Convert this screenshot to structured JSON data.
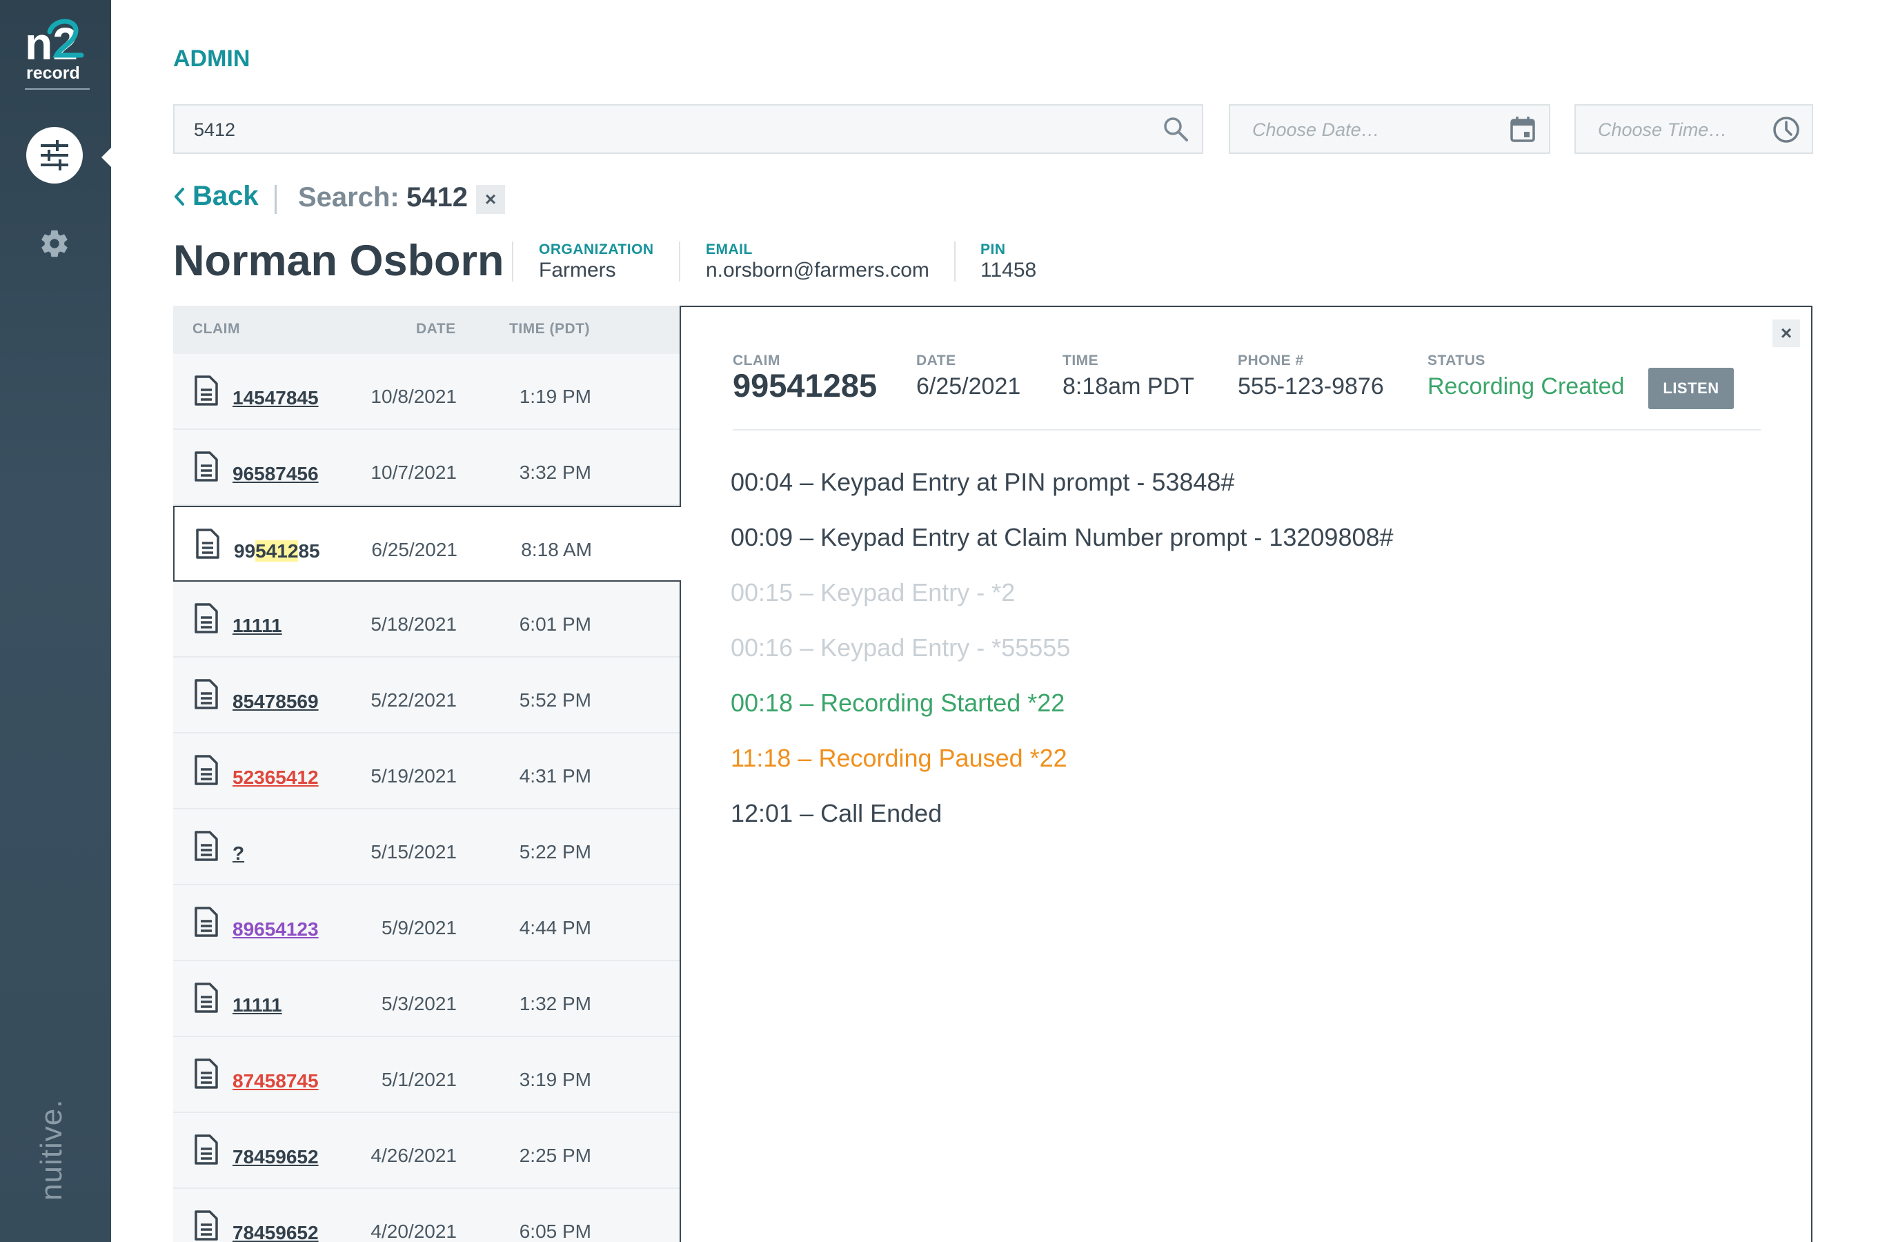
{
  "brand": {
    "logo_mark": "n2",
    "logo_text": "record",
    "vendor": "nuitive."
  },
  "sidebar": {
    "items": [
      {
        "name": "filters",
        "icon": "sliders-icon",
        "active": true
      },
      {
        "name": "settings",
        "icon": "gear-icon",
        "active": false
      }
    ]
  },
  "header": {
    "title": "ADMIN"
  },
  "search": {
    "value": "5412",
    "date_placeholder": "Choose Date…",
    "time_placeholder": "Choose Time…"
  },
  "breadcrumb": {
    "back_label": "Back",
    "search_label": "Search:",
    "search_term": "5412",
    "clear_symbol": "×"
  },
  "user": {
    "name": "Norman Osborn",
    "organization_label": "ORGANIZATION",
    "organization": "Farmers",
    "email_label": "EMAIL",
    "email": "n.orsborn@farmers.com",
    "pin_label": "PIN",
    "pin": "11458"
  },
  "list": {
    "columns": [
      "CLAIM",
      "DATE",
      "TIME (PDT)"
    ],
    "rows": [
      {
        "claim": "14547845",
        "date": "10/8/2021",
        "time": "1:19 PM",
        "color": "#33414c"
      },
      {
        "claim": "96587456",
        "date": "10/7/2021",
        "time": "3:32 PM",
        "color": "#33414c"
      },
      {
        "claim_pre": "99",
        "claim_match": "5412",
        "claim_post": "85",
        "date": "6/25/2021",
        "time": "8:18 AM",
        "color": "#33414c",
        "selected": true
      },
      {
        "claim": "11111",
        "date": "5/18/2021",
        "time": "6:01 PM",
        "color": "#33414c"
      },
      {
        "claim": "85478569",
        "date": "5/22/2021",
        "time": "5:52 PM",
        "color": "#33414c"
      },
      {
        "claim": "52365412",
        "date": "5/19/2021",
        "time": "4:31 PM",
        "color": "#e0463c"
      },
      {
        "claim": "?",
        "date": "5/15/2021",
        "time": "5:22 PM",
        "color": "#33414c"
      },
      {
        "claim": "89654123",
        "date": "5/9/2021",
        "time": "4:44 PM",
        "color": "#8e4fc4"
      },
      {
        "claim": "11111",
        "date": "5/3/2021",
        "time": "1:32 PM",
        "color": "#33414c"
      },
      {
        "claim": "87458745",
        "date": "5/1/2021",
        "time": "3:19 PM",
        "color": "#e0463c"
      },
      {
        "claim": "78459652",
        "date": "4/26/2021",
        "time": "2:25 PM",
        "color": "#33414c"
      },
      {
        "claim": "78459652",
        "date": "4/20/2021",
        "time": "6:05 PM",
        "color": "#33414c"
      }
    ]
  },
  "detail": {
    "close_symbol": "×",
    "claim_label": "CLAIM",
    "claim": "99541285",
    "date_label": "DATE",
    "date": "6/25/2021",
    "time_label": "TIME",
    "time": "8:18am PDT",
    "phone_label": "PHONE #",
    "phone": "555-123-9876",
    "status_label": "STATUS",
    "status": "Recording Created",
    "status_color": "#3aa56a",
    "listen_label": "LISTEN",
    "events": [
      {
        "text": "00:04 – Keypad Entry at PIN prompt - 53848#",
        "color": "#3a4752"
      },
      {
        "text": "00:09 – Keypad Entry at Claim Number prompt - 13209808#",
        "color": "#3a4752"
      },
      {
        "text": "00:15 – Keypad Entry - *2",
        "color": "#c9d0d5"
      },
      {
        "text": "00:16 – Keypad Entry - *55555",
        "color": "#c9d0d5"
      },
      {
        "text": "00:18 – Recording Started *22",
        "color": "#3aa56a"
      },
      {
        "text": "11:18 – Recording Paused *22",
        "color": "#f0901c"
      },
      {
        "text": "12:01 – Call Ended",
        "color": "#3a4752"
      }
    ]
  }
}
